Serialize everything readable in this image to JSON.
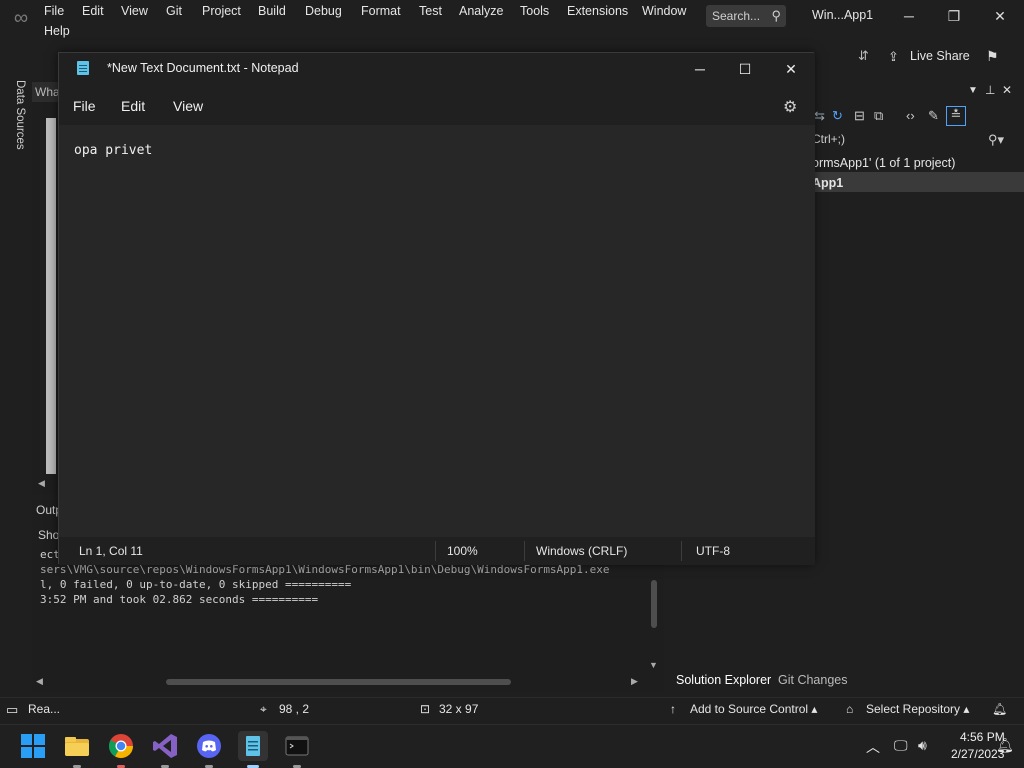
{
  "vs": {
    "menu": [
      "File",
      "Edit",
      "View",
      "Git",
      "Project",
      "Build",
      "Debug",
      "Format",
      "Test",
      "Analyze",
      "Tools",
      "Extensions",
      "Window",
      "Help"
    ],
    "search_label": "Search...",
    "title": "Win...App1",
    "live_share": "Live Share",
    "data_sources_tab": "Data Sources",
    "editor_tab": "Wha",
    "output_tab": "Outp",
    "output_show": "Sho",
    "output_lines": [
      "ect",
      "sers\\VMG\\source\\repos\\WindowsFormsApp1\\WindowsFormsApp1\\bin\\Debug\\WindowsFormsApp1.exe",
      "l, 0 failed, 0 up-to-date, 0 skipped ==========",
      "3:52 PM and took 02.862 seconds =========="
    ],
    "solution": {
      "search": "Ctrl+;)",
      "line1": "ormsApp1' (1 of 1 project)",
      "line2": "App1",
      "tabs": [
        "Solution Explorer",
        "Git Changes"
      ]
    },
    "status": {
      "ready": "Rea...",
      "position": "98 , 2",
      "size": "32 x 97",
      "source_control": "Add to Source Control",
      "repository": "Select Repository"
    }
  },
  "notepad": {
    "title": "*New Text Document.txt - Notepad",
    "menu": [
      "File",
      "Edit",
      "View"
    ],
    "content": "opa privet",
    "status": {
      "position": "Ln 1, Col 11",
      "zoom": "100%",
      "line_ending": "Windows (CRLF)",
      "encoding": "UTF-8"
    }
  },
  "taskbar": {
    "time": "4:56 PM",
    "date": "2/27/2023",
    "apps": [
      "start-icon",
      "file-explorer-icon",
      "chrome-icon",
      "visual-studio-icon",
      "discord-icon",
      "notepad-icon",
      "terminal-icon"
    ]
  },
  "colors": {
    "vs_bg": "#1f1f1f",
    "notepad_text_bg": "#272727",
    "accent_blue": "#0078d4"
  }
}
